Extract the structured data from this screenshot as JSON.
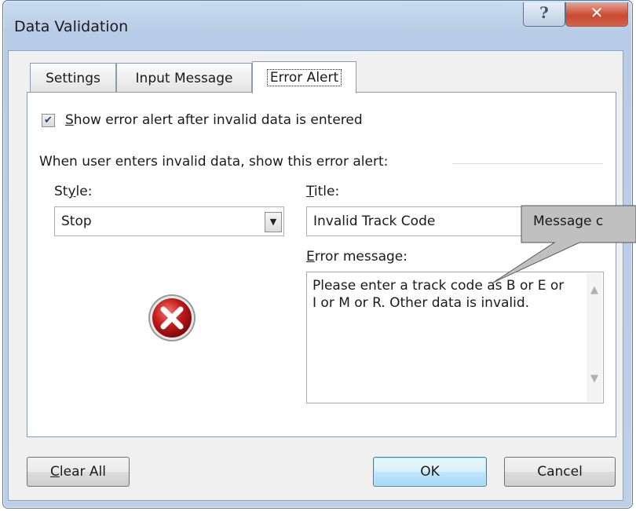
{
  "window": {
    "title": "Data Validation",
    "help_icon": "?",
    "close_icon": "✕"
  },
  "tabs": [
    {
      "label": "Settings",
      "active": false
    },
    {
      "label": "Input Message",
      "active": false
    },
    {
      "label": "Error Alert",
      "active": true
    }
  ],
  "error_alert": {
    "show_checkbox_checked": true,
    "show_checkbox_label_first": "S",
    "show_checkbox_label_rest": "how error alert after invalid data is entered",
    "group_label": "When user enters invalid data, show this error alert:",
    "style_label_pre": "St",
    "style_label_ul": "y",
    "style_label_post": "le:",
    "style_value": "Stop",
    "title_label_ul": "T",
    "title_label_post": "itle:",
    "title_value": "Invalid Track Code",
    "message_label_ul": "E",
    "message_label_post": "rror message:",
    "message_value": "Please enter a track code as B or E or I or M or R. Other data is invalid.",
    "icon": "error-stop-icon"
  },
  "buttons": {
    "clear_all_ul": "C",
    "clear_all_rest": "lear All",
    "ok": "OK",
    "cancel": "Cancel"
  },
  "callout": {
    "text": "Message c"
  },
  "colors": {
    "title_bar": "#bcd0ea",
    "close_button": "#c94a31",
    "error_icon": "#c41a1a",
    "callout_fill": "#c0c0c0"
  }
}
